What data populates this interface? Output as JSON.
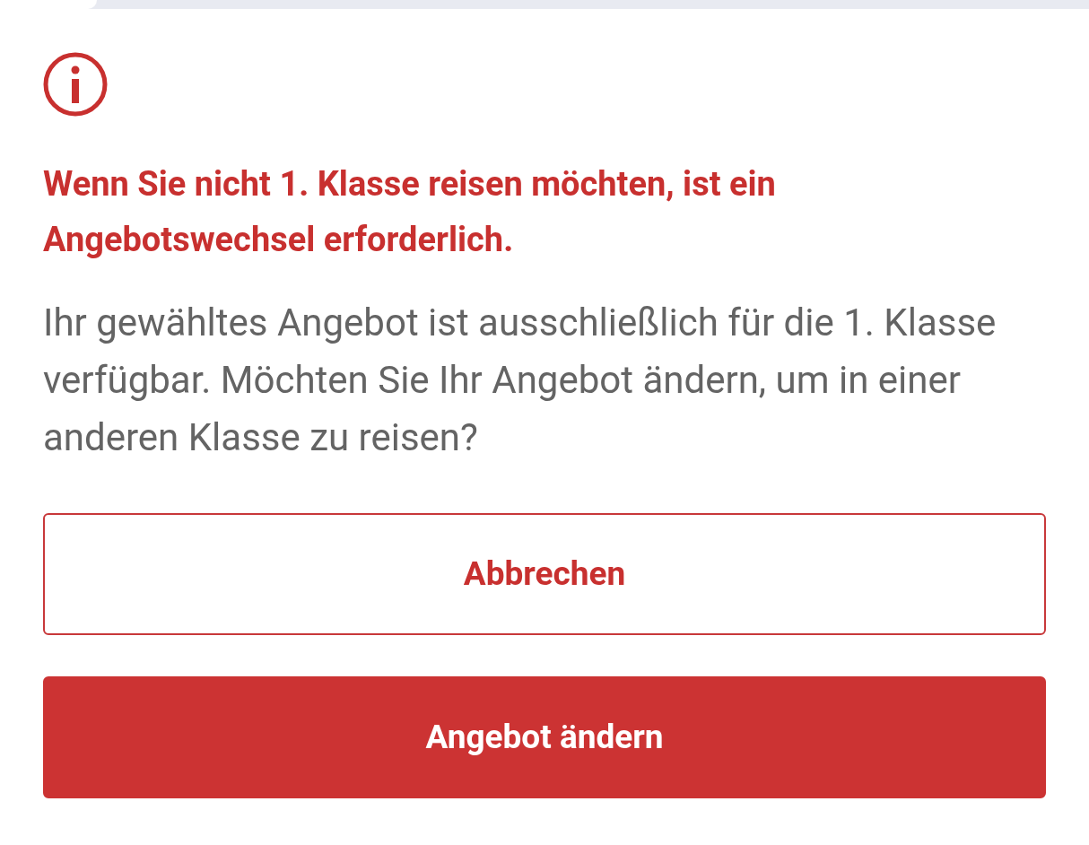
{
  "dialog": {
    "heading": "Wenn Sie nicht 1. Klasse reisen möchten, ist ein Angebotswechsel erforderlich.",
    "message": "Ihr gewähltes Angebot ist ausschließlich für die 1. Klasse verfügbar. Möchten Sie Ihr Angebot ändern, um in einer anderen Klasse zu reisen?",
    "buttons": [
      {
        "label": "Abbrechen",
        "kind": "secondary"
      },
      {
        "label": "Angebot ändern",
        "kind": "primary"
      }
    ]
  }
}
